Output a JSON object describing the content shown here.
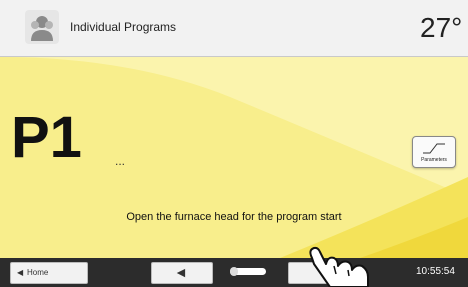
{
  "header": {
    "title": "Individual Programs",
    "temperature": "27°",
    "icon": "user-icon"
  },
  "main": {
    "program_name": "P1",
    "program_suffix": "...",
    "parameters_label": "Parameters",
    "message": "Open the furnace head for the program start"
  },
  "footer": {
    "home_label": "Home",
    "time": "10:55:54"
  },
  "colors": {
    "main_background": "#f8ee8c",
    "header_background": "#f2f2f2",
    "footer_background": "#2c2c2c"
  }
}
